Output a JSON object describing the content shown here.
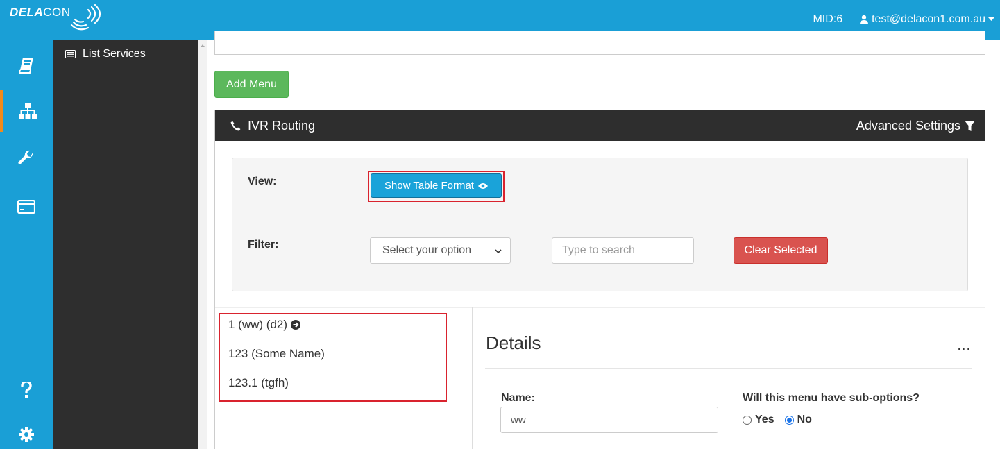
{
  "header": {
    "logo_bold": "DELA",
    "logo_light": "CON",
    "mid": "MID:6",
    "user_email": "test@delacon1.com.au"
  },
  "nav": {
    "icons": [
      "book-icon",
      "sitemap-icon",
      "wrench-icon",
      "credit-card-icon",
      "help-icon",
      "gear-icon"
    ],
    "active_color": "#f08a1c"
  },
  "sidebar": {
    "items": [
      {
        "label": "List Services",
        "icon": "list-icon"
      }
    ]
  },
  "main": {
    "add_menu_label": "Add Menu",
    "panel": {
      "title": "IVR Routing",
      "advanced_label": "Advanced Settings"
    },
    "view": {
      "label": "View:",
      "button_label": "Show Table Format"
    },
    "filter": {
      "label": "Filter:",
      "select_value": "Select your option",
      "search_placeholder": "Type to search",
      "clear_label": "Clear Selected"
    },
    "tree": [
      {
        "label": "1 (ww) (d2)"
      },
      {
        "label": "123 (Some Name)"
      },
      {
        "label": "123.1 (tgfh)"
      }
    ],
    "details": {
      "title": "Details",
      "menu_dots": "...",
      "name_label": "Name:",
      "name_value": "ww",
      "suboptions_label": "Will this menu have sub-options?",
      "yes_label": "Yes",
      "no_label": "No",
      "selected": "No"
    }
  },
  "colors": {
    "brand": "#1a9fd6",
    "dark": "#2e2e2e",
    "success": "#5cb85c",
    "info": "#1aa3d9",
    "danger": "#d9534f",
    "highlight": "#d9232e"
  }
}
